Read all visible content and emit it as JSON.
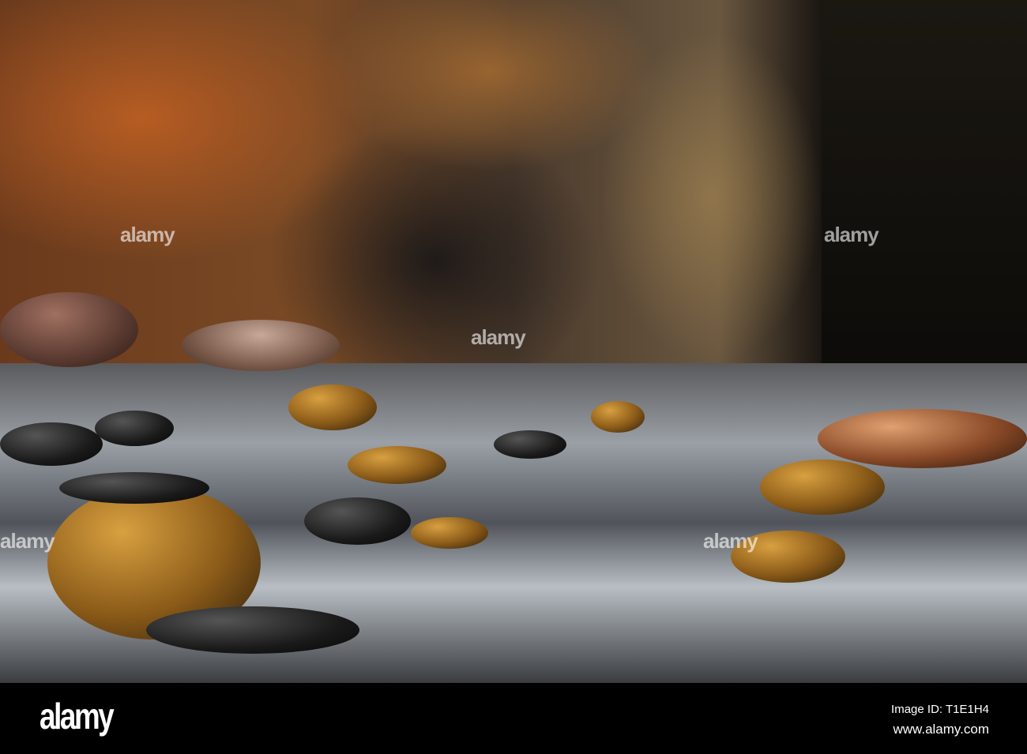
{
  "watermark": "alamy",
  "footer": {
    "logo": "alamy",
    "image_id": "Image ID: T1E1H4",
    "website": "www.alamy.com"
  }
}
